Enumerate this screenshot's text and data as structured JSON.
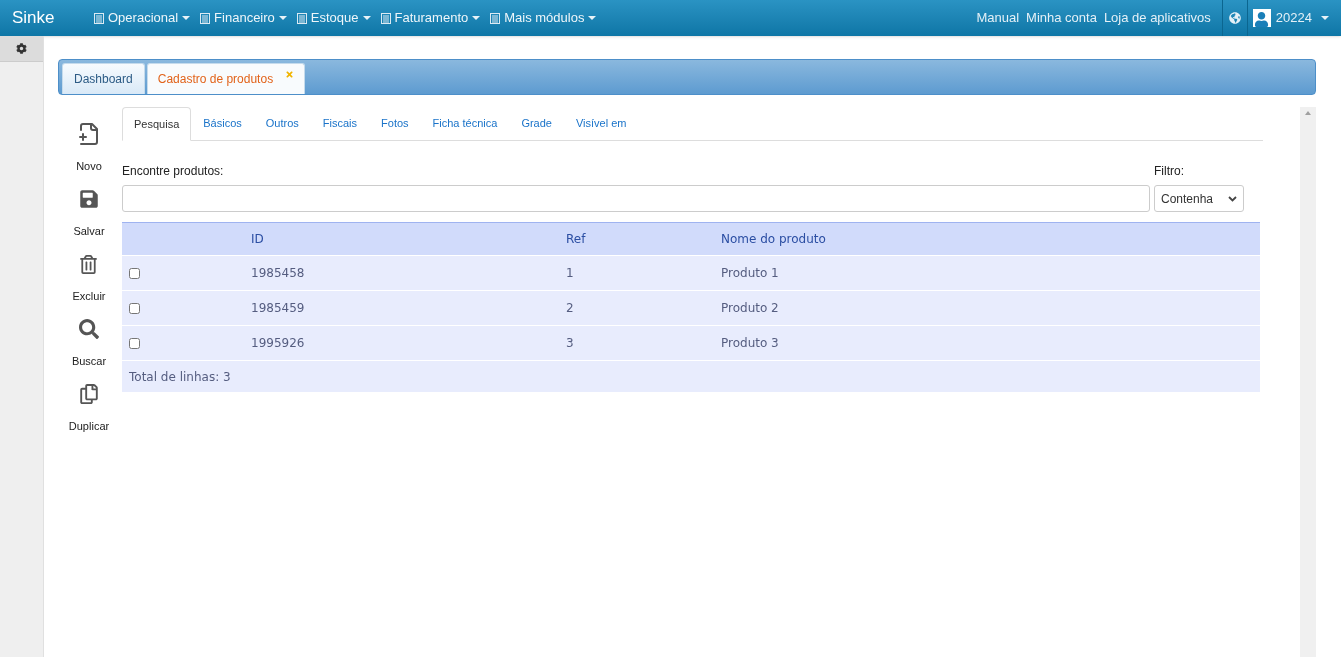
{
  "brand": "Sinke",
  "menu": [
    {
      "label": "Operacional"
    },
    {
      "label": "Financeiro"
    },
    {
      "label": "Estoque"
    },
    {
      "label": "Faturamento"
    },
    {
      "label": "Mais módulos"
    }
  ],
  "top_links": [
    "Manual",
    "Minha conta",
    "Loja de aplicativos"
  ],
  "user": "20224",
  "window_tabs": [
    {
      "label": "Dashboard",
      "selected": false,
      "closable": false
    },
    {
      "label": "Cadastro de produtos",
      "selected": true,
      "closable": true
    }
  ],
  "actions": [
    {
      "kind": "new",
      "label": "Novo"
    },
    {
      "kind": "save",
      "label": "Salvar"
    },
    {
      "kind": "delete",
      "label": "Excluir"
    },
    {
      "kind": "search",
      "label": "Buscar"
    },
    {
      "kind": "duplicate",
      "label": "Duplicar"
    }
  ],
  "tabs": [
    {
      "label": "Pesquisa",
      "selected": true
    },
    {
      "label": "Básicos",
      "selected": false
    },
    {
      "label": "Outros",
      "selected": false
    },
    {
      "label": "Fiscais",
      "selected": false
    },
    {
      "label": "Fotos",
      "selected": false
    },
    {
      "label": "Ficha técnica",
      "selected": false
    },
    {
      "label": "Grade",
      "selected": false
    },
    {
      "label": "Visível em",
      "selected": false
    }
  ],
  "search": {
    "label": "Encontre produtos:"
  },
  "filter": {
    "label": "Filtro:",
    "value": "Contenha"
  },
  "table": {
    "columns": [
      "ID",
      "Ref",
      "Nome do produto"
    ],
    "rows": [
      {
        "checked": false,
        "cells": [
          "1985458",
          "1",
          "Produto 1"
        ]
      },
      {
        "checked": false,
        "cells": [
          "1985459",
          "2",
          "Produto 2"
        ]
      },
      {
        "checked": false,
        "cells": [
          "1995926",
          "3",
          "Produto 3"
        ]
      }
    ],
    "footer": "Total de linhas: 3"
  }
}
